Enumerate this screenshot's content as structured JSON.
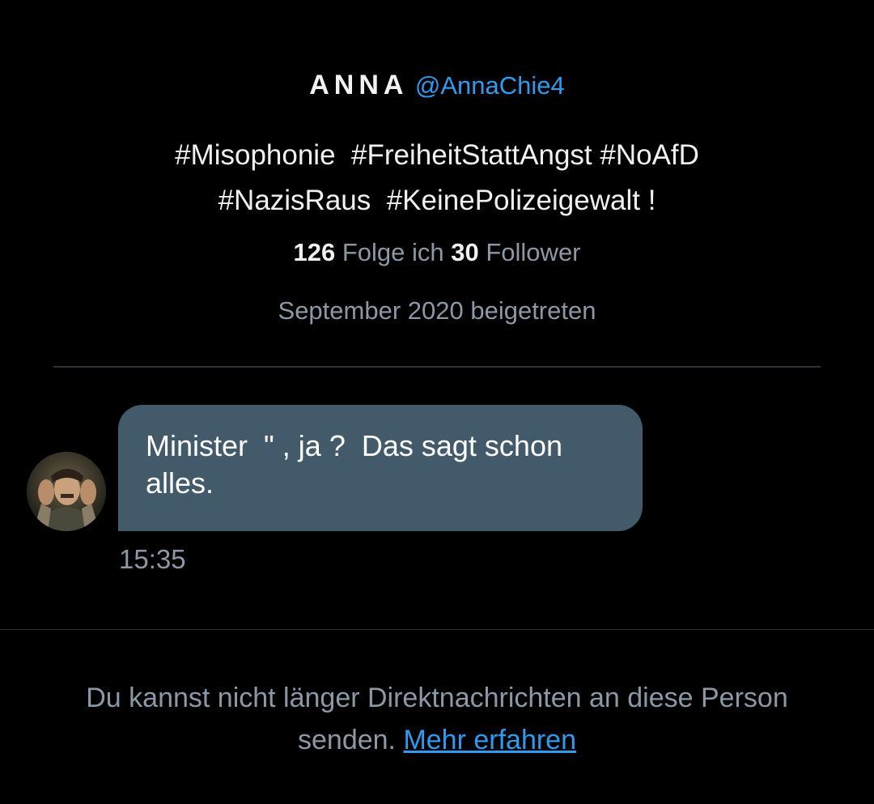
{
  "profile": {
    "display_name": "ANNA",
    "handle": "@AnnaChie4",
    "bio_lines": [
      "#Misophonie  #FreiheitStattAngst #NoAfD",
      "#NazisRaus  #KeinePolizeigewalt !"
    ],
    "following_count": "126",
    "following_label": "Folge ich",
    "followers_count": "30",
    "followers_label": "Follower",
    "joined": "September 2020 beigetreten"
  },
  "conversation": {
    "message_lines": [
      "Minister  \" , ja ?  Das sagt schon",
      "alles."
    ],
    "timestamp": "15:35"
  },
  "footer": {
    "notice_text": "Du kannst nicht länger Direktnachrichten an diese Person",
    "notice_text_2": "senden.",
    "learn_more": "Mehr erfahren"
  },
  "colors": {
    "background": "#000000",
    "accent": "#2d9bf0",
    "bubble": "#435a6b",
    "muted": "#8b98a5"
  }
}
